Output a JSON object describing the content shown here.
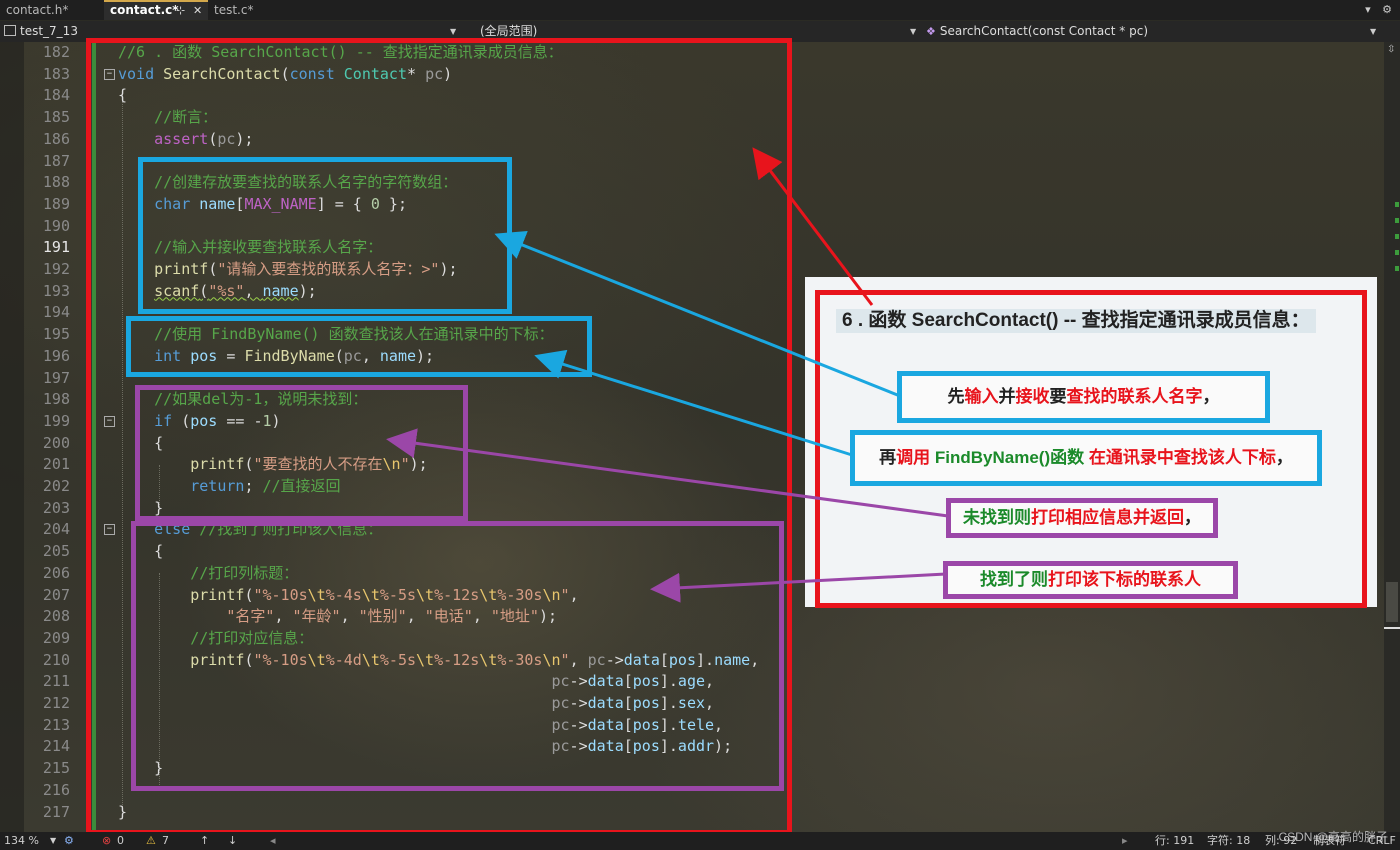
{
  "tabs": [
    {
      "label": "contact.h*",
      "active": false
    },
    {
      "label": "contact.c*",
      "active": true
    },
    {
      "label": "test.c*",
      "active": false
    }
  ],
  "tab_icons": {
    "pin": "⊹",
    "close": "✕"
  },
  "navbar": {
    "project": "test_7_13",
    "scope": "(全局范围)",
    "function": "SearchContact(const Contact * pc)"
  },
  "editor": {
    "current_line": 191,
    "lines": [
      182,
      183,
      184,
      185,
      186,
      187,
      188,
      189,
      190,
      191,
      192,
      193,
      194,
      195,
      196,
      197,
      198,
      199,
      200,
      201,
      202,
      203,
      204,
      205,
      206,
      207,
      208,
      209,
      210,
      211,
      212,
      213,
      214,
      215,
      216,
      217
    ]
  },
  "panel": {
    "title": "6 . 函数 SearchContact() -- 查找指定通讯录成员信息：",
    "ann1": {
      "p1": "先",
      "p2": "输入",
      "p3": "并",
      "p4": "接收",
      "p5": "要",
      "p6": "查找的联系人名字",
      "p7": "，"
    },
    "ann2": {
      "p1": "再",
      "p2": "调用",
      "p3": " FindByName()函数 ",
      "p4": "在通讯录中查找该人下标",
      "p5": "，"
    },
    "ann3": {
      "p1": "未找到则",
      "p2": "打印相应信息并返回",
      "p3": "，"
    },
    "ann4": {
      "p1": "找到了则",
      "p2": "打印该下标的联系人"
    }
  },
  "colors": {
    "red": "#e8141c",
    "blue": "#1aa7e0",
    "purple": "#9b47a8",
    "green": "#1b8a2a"
  },
  "status": {
    "zoom": "134 %",
    "errors": "0",
    "warnings": "7",
    "line": "行: 191",
    "char": "字符: 18",
    "col": "列: 92",
    "tabs": "制表符",
    "eol": "CRLF"
  },
  "watermark": "CSDN @高高的胖子"
}
